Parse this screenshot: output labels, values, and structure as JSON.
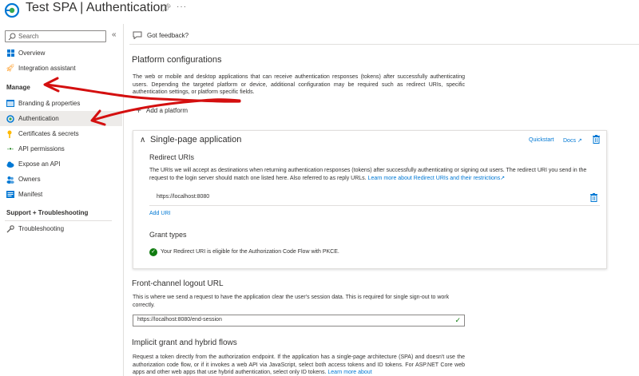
{
  "header": {
    "title": "Test SPA | Authentication",
    "pin_icon": "pin-icon",
    "more_icon": "more-icon"
  },
  "sidebar": {
    "search_placeholder": "Search",
    "items_top": [
      {
        "label": "Overview",
        "icon": "overview-icon"
      },
      {
        "label": "Integration assistant",
        "icon": "rocket-icon"
      }
    ],
    "manage_header": "Manage",
    "manage_items": [
      {
        "label": "Branding & properties",
        "icon": "branding-icon"
      },
      {
        "label": "Authentication",
        "icon": "authentication-icon",
        "active": true
      },
      {
        "label": "Certificates & secrets",
        "icon": "key-icon"
      },
      {
        "label": "API permissions",
        "icon": "api-permissions-icon"
      },
      {
        "label": "Expose an API",
        "icon": "cloud-icon"
      },
      {
        "label": "Owners",
        "icon": "owners-icon"
      },
      {
        "label": "Manifest",
        "icon": "manifest-icon"
      }
    ],
    "support_header": "Support + Troubleshooting",
    "support_items": [
      {
        "label": "Troubleshooting",
        "icon": "wrench-icon"
      }
    ]
  },
  "toolbar": {
    "feedback_label": "Got feedback?"
  },
  "platform": {
    "heading": "Platform configurations",
    "description": "The web or mobile and desktop applications that can receive authentication responses (tokens) after successfully authenticating users. Depending the targeted platform or device, additional configuration may be required such as redirect URIs, specific authentication settings, or platform specific fields.",
    "add_platform_label": "Add a platform"
  },
  "spa_card": {
    "title": "Single-page application",
    "quickstart_label": "Quickstart",
    "docs_label": "Docs",
    "redirect_heading": "Redirect URIs",
    "redirect_desc": "The URIs we will accept as destinations when returning authentication responses (tokens) after successfully authenticating or signing out users. The redirect URI you send in the request to the login server should match one listed here. Also referred to as reply URLs.",
    "redirect_link": "Learn more about Redirect URIs and their restrictions",
    "uri_value": "https://localhost:8080",
    "add_uri_label": "Add URI",
    "grant_heading": "Grant types",
    "grant_status": "Your Redirect URI is eligible for the Authorization Code Flow with PKCE."
  },
  "logout": {
    "heading": "Front-channel logout URL",
    "desc": "This is where we send a request to have the application clear the user's session data. This is required for single sign-out to work correctly.",
    "value": "https://localhost:8080/end-session"
  },
  "implicit": {
    "heading": "Implicit grant and hybrid flows",
    "desc": "Request a token directly from the authorization endpoint. If the application has a single-page architecture (SPA) and doesn't use the authorization code flow, or if it invokes a web API via JavaScript, select both access tokens and ID tokens. For ASP.NET Core web apps and other web apps that use hybrid authentication, select only ID tokens.",
    "link": "Learn more about"
  },
  "colors": {
    "accent": "#0078d4",
    "success": "#107c10",
    "annotation": "#d40f0f",
    "active_bg": "#edebe9"
  }
}
